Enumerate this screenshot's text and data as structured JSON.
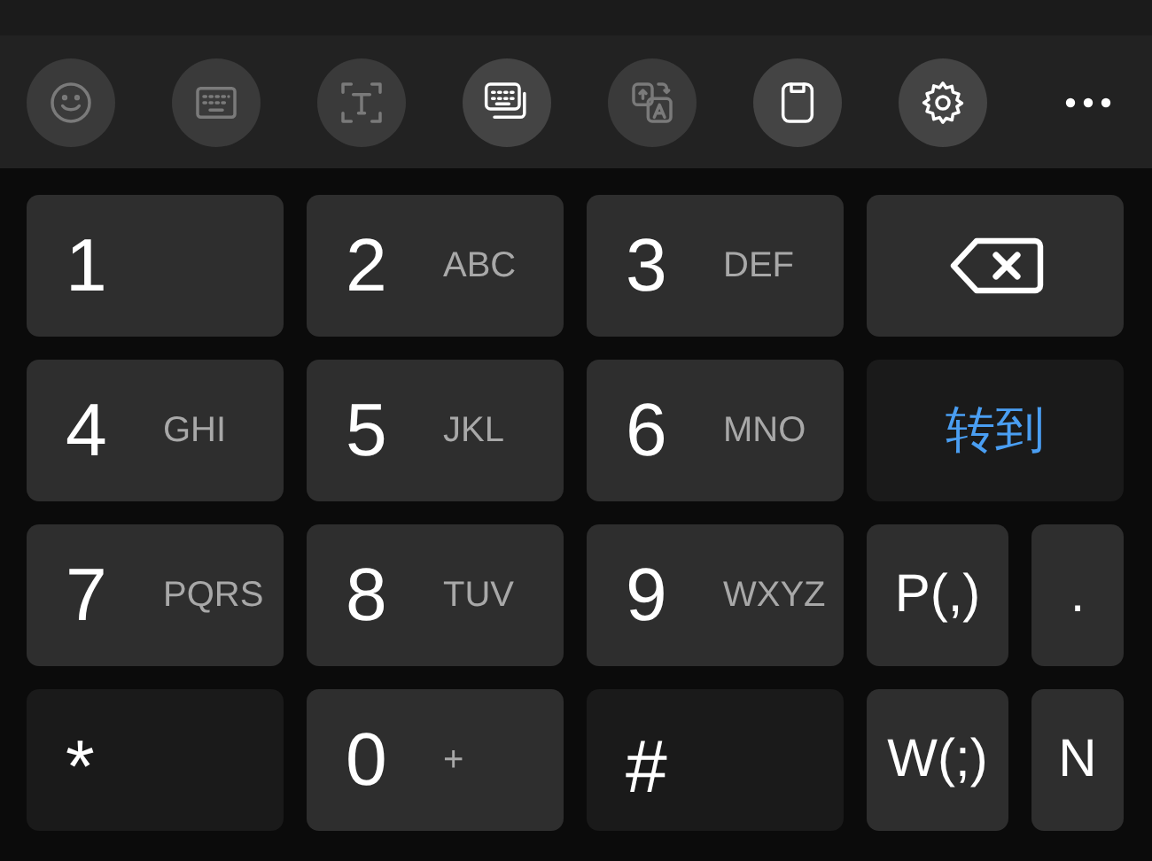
{
  "toolbar": {
    "buttons": [
      {
        "disabled": true
      },
      {
        "disabled": true
      },
      {
        "disabled": true
      },
      {
        "disabled": false
      },
      {
        "disabled": true
      },
      {
        "disabled": false
      },
      {
        "disabled": false
      },
      {
        "disabled": false
      }
    ]
  },
  "keypad": {
    "keys": [
      {
        "kind": "digit",
        "label": "1"
      },
      {
        "kind": "digit",
        "label": "2",
        "letters": "ABC"
      },
      {
        "kind": "digit",
        "label": "3",
        "letters": "DEF"
      },
      {
        "kind": "backspace"
      },
      {
        "kind": "digit",
        "label": "4",
        "letters": "GHI"
      },
      {
        "kind": "digit",
        "label": "5",
        "letters": "JKL"
      },
      {
        "kind": "digit",
        "label": "6",
        "letters": "MNO"
      },
      {
        "kind": "action",
        "label": "转到"
      },
      {
        "kind": "digit",
        "label": "7",
        "letters": "PQRS"
      },
      {
        "kind": "digit",
        "label": "8",
        "letters": "TUV"
      },
      {
        "kind": "digit",
        "label": "9",
        "letters": "WXYZ"
      },
      {
        "kind": "small",
        "label": "P(,)"
      },
      {
        "kind": "small",
        "label": "."
      },
      {
        "kind": "symbol",
        "label": "*"
      },
      {
        "kind": "digit",
        "label": "0",
        "letters": "+"
      },
      {
        "kind": "symbol",
        "label": "#"
      },
      {
        "kind": "small",
        "label": "W(;)"
      },
      {
        "kind": "small",
        "label": "N"
      }
    ]
  }
}
